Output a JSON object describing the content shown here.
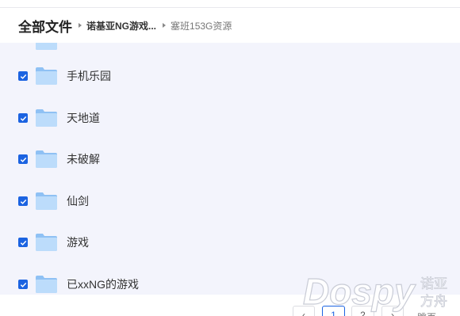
{
  "breadcrumb": {
    "root": "全部文件",
    "middle": "诺基亚NG游戏...",
    "current": "塞班153G资源"
  },
  "folders": [
    {
      "name": "手机乐园",
      "checked": true
    },
    {
      "name": "天地道",
      "checked": true
    },
    {
      "name": "未破解",
      "checked": true
    },
    {
      "name": "仙剑",
      "checked": true
    },
    {
      "name": "游戏",
      "checked": true
    },
    {
      "name": "已xxNG的游戏",
      "checked": true
    }
  ],
  "pagination": {
    "prev": "‹",
    "current_page": "1",
    "next_page": "2",
    "next": "›",
    "jump_label": "跳页"
  },
  "watermark": {
    "brand": "Dospy",
    "line1": "诺亚",
    "line2": "方舟"
  },
  "colors": {
    "accent": "#1b63e1",
    "list_bg": "#f3f4fc",
    "folder_light": "#bcdcfb",
    "folder_dark": "#8fc1f4"
  }
}
